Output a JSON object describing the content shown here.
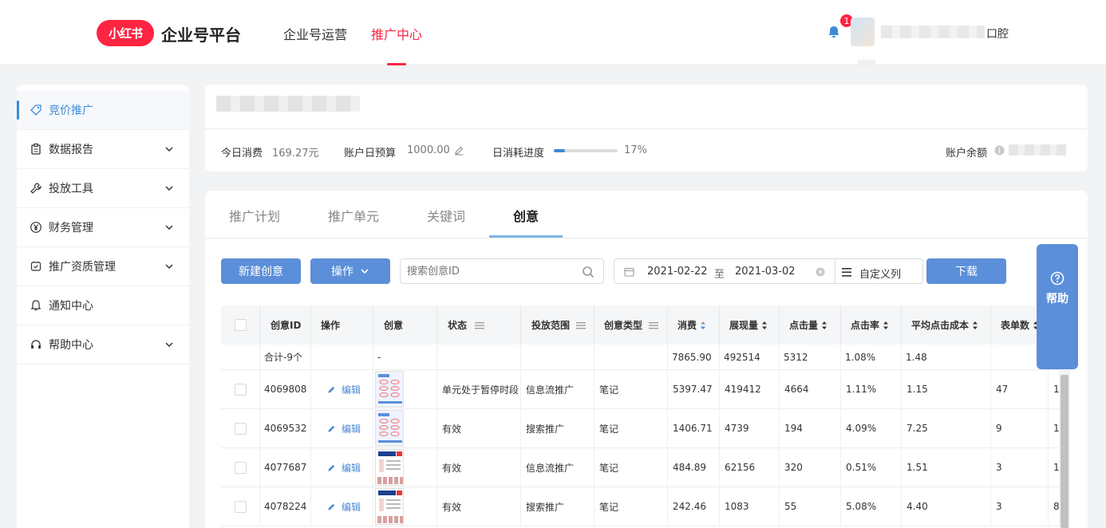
{
  "header": {
    "logo_text": "小红书",
    "platform_name": "企业号平台",
    "nav": [
      {
        "label": "企业号运营"
      },
      {
        "label": "推广中心"
      }
    ],
    "notification_count": "1",
    "account_suffix": "口腔"
  },
  "sidebar": {
    "items": [
      {
        "label": "竞价推广",
        "icon": "tag-icon"
      },
      {
        "label": "数据报告",
        "icon": "clipboard-icon"
      },
      {
        "label": "投放工具",
        "icon": "wrench-icon"
      },
      {
        "label": "财务管理",
        "icon": "yen-icon"
      },
      {
        "label": "推广资质管理",
        "icon": "shield-check-icon"
      },
      {
        "label": "通知中心",
        "icon": "bell-icon"
      },
      {
        "label": "帮助中心",
        "icon": "headset-icon"
      }
    ]
  },
  "summary": {
    "today_spend_label": "今日消费",
    "today_spend_value": "169.27元",
    "daily_budget_label": "账户日预算",
    "daily_budget_value": "1000.00",
    "progress_label": "日消耗进度",
    "progress_percent": 17,
    "progress_text": "17%",
    "balance_label": "账户余额"
  },
  "tabs": [
    {
      "label": "推广计划"
    },
    {
      "label": "推广单元"
    },
    {
      "label": "关键词"
    },
    {
      "label": "创意"
    }
  ],
  "toolbar": {
    "new_button": "新建创意",
    "action_button": "操作",
    "search_placeholder": "搜索创意ID",
    "date_start": "2021-02-22",
    "date_sep": "至",
    "date_end": "2021-03-02",
    "custom_columns": "自定义列",
    "download_button": "下载"
  },
  "table": {
    "columns": [
      "创意ID",
      "操作",
      "创意",
      "状态",
      "投放范围",
      "创意类型",
      "消费",
      "展现量",
      "点击量",
      "点击率",
      "平均点击成本",
      "表单数"
    ],
    "total_row": {
      "label": "合计-9个",
      "creative": "-",
      "spend": "7865.90",
      "impressions": "492514",
      "clicks": "5312",
      "ctr": "1.08%",
      "cpc": "1.48"
    },
    "edit_label": "编辑",
    "rows": [
      {
        "id": "4069808",
        "status": "单元处于暂停时段",
        "scope": "信息流推广",
        "type": "笔记",
        "spend": "5397.47",
        "impressions": "419412",
        "clicks": "4664",
        "ctr": "1.11%",
        "cpc": "1.15",
        "forms": "47",
        "more": "1"
      },
      {
        "id": "4069532",
        "status": "有效",
        "scope": "搜索推广",
        "type": "笔记",
        "spend": "1406.71",
        "impressions": "4739",
        "clicks": "194",
        "ctr": "4.09%",
        "cpc": "7.25",
        "forms": "9",
        "more": "1"
      },
      {
        "id": "4077687",
        "status": "有效",
        "scope": "信息流推广",
        "type": "笔记",
        "spend": "484.89",
        "impressions": "62156",
        "clicks": "320",
        "ctr": "0.51%",
        "cpc": "1.51",
        "forms": "3",
        "more": "1"
      },
      {
        "id": "4078224",
        "status": "有效",
        "scope": "搜索推广",
        "type": "笔记",
        "spend": "242.46",
        "impressions": "1083",
        "clicks": "55",
        "ctr": "5.08%",
        "cpc": "4.40",
        "forms": "3",
        "more": "8"
      }
    ]
  },
  "help": {
    "label": "帮助"
  },
  "colors": {
    "brand_red": "#ff2442",
    "primary_blue": "#5b8fd9",
    "link_blue": "#4a86d6"
  }
}
